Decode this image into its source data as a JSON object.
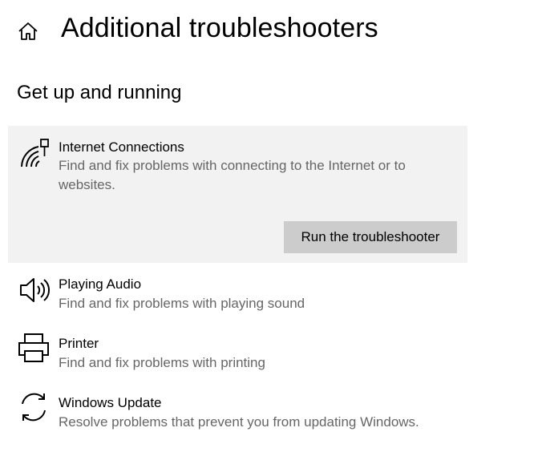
{
  "header": {
    "home_icon": "home-icon",
    "title": "Additional troubleshooters"
  },
  "section": {
    "title": "Get up and running"
  },
  "troubleshooters": [
    {
      "icon": "wifi-network-icon",
      "title": "Internet Connections",
      "description": "Find and fix problems with connecting to the Internet or to websites.",
      "selected": true,
      "run_label": "Run the troubleshooter"
    },
    {
      "icon": "speaker-icon",
      "title": "Playing Audio",
      "description": "Find and fix problems with playing sound"
    },
    {
      "icon": "printer-icon",
      "title": "Printer",
      "description": "Find and fix problems with printing"
    },
    {
      "icon": "sync-icon",
      "title": "Windows Update",
      "description": "Resolve problems that prevent you from updating Windows."
    }
  ],
  "colors": {
    "selected_background": "#f2f2f2",
    "button_background": "#cccccc",
    "description_text": "#666666"
  }
}
